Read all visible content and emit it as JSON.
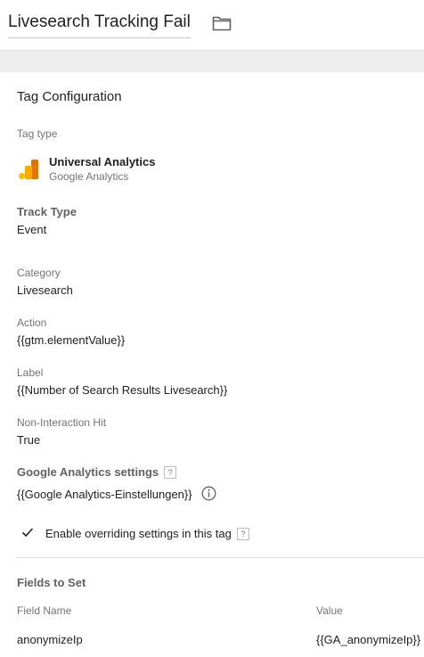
{
  "header": {
    "title": "Livesearch Tracking Fail",
    "folder_icon": "folder-icon"
  },
  "tag_configuration": {
    "section_title": "Tag Configuration",
    "tag_type_label": "Tag type",
    "tag_type_name": "Universal Analytics",
    "tag_type_vendor": "Google Analytics",
    "tag_type_icon": "google-analytics-logo",
    "track_type_label": "Track Type",
    "track_type_value": "Event",
    "category_label": "Category",
    "category_value": "Livesearch",
    "action_label": "Action",
    "action_value": "{{gtm.elementValue}}",
    "label_label": "Label",
    "label_value": "{{Number of Search Results Livesearch}}",
    "non_interaction_label": "Non-Interaction Hit",
    "non_interaction_value": "True",
    "ga_settings_label": "Google Analytics settings",
    "ga_settings_help": "?",
    "ga_settings_value": "{{Google Analytics-Einstellungen}}",
    "info_icon": "info-icon",
    "override_label": "Enable overriding settings in this tag",
    "override_help": "?",
    "check_icon": "check-icon"
  },
  "fields_to_set": {
    "title": "Fields to Set",
    "columns": [
      "Field Name",
      "Value"
    ],
    "rows": [
      {
        "field_name": "anonymizeIp",
        "value": "{{GA_anonymizeIp}}"
      }
    ]
  },
  "colors": {
    "ga_dark": "#e37400",
    "ga_mid": "#f9ab00",
    "ga_light": "#fbbc04"
  }
}
